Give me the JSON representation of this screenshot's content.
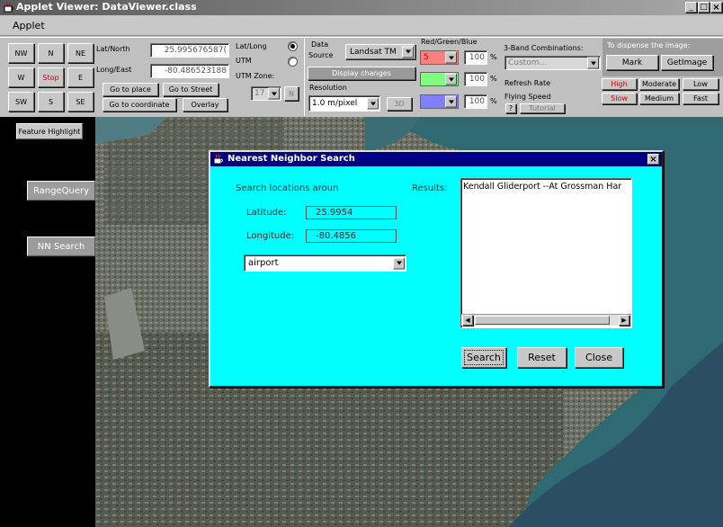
{
  "window": {
    "title": "Applet Viewer: DataViewer.class",
    "menu": "Applet",
    "controls": [
      "_",
      "□",
      "×"
    ]
  },
  "nav": {
    "buttons": [
      "NW",
      "N",
      "NE",
      "W",
      "Stop",
      "E",
      "SW",
      "S",
      "SE"
    ]
  },
  "coords": {
    "lat_label": "Lat/North",
    "lat_value": "25.995676587(",
    "long_label": "Long/East",
    "long_value": "-80.486523188",
    "go_place": "Go to place",
    "go_street": "Go to Street",
    "go_coord": "Go to coordinate",
    "overlay": "Overlay",
    "latlong_label": "Lat/Long",
    "utm_label": "UTM",
    "utm_zone_label": "UTM Zone:",
    "utm_zone_value": "17",
    "utm_hemi": "N"
  },
  "datasource": {
    "label1": "Data",
    "label2": "Source",
    "value": "Landsat TM",
    "display_changes": "Display changes",
    "resolution_label": "Resolution",
    "resolution_value": "1.0 m/pixel",
    "btn_3d": "3D"
  },
  "rgb": {
    "title": "Red/Green/Blue",
    "r_value": "100",
    "g_value": "100",
    "b_value": "100",
    "pct": "%",
    "r_sel": "5"
  },
  "band": {
    "title": "3-Band Combinations:",
    "value": "Custom...",
    "refresh_label": "Refresh Rate",
    "flying_label": "Flying Speed",
    "help": "?",
    "tutorial": "Tutorial"
  },
  "image": {
    "title": "To dispense the image:",
    "mark": "Mark",
    "getimage": "GetImage",
    "rate_high": "High",
    "rate_moderate": "Moderate",
    "rate_low": "Low",
    "speed_slow": "Slow",
    "speed_medium": "Medium",
    "speed_fast": "Fast"
  },
  "side": {
    "feature": "Feature Highlight",
    "range": "RangeQuery",
    "nn": "NN Search"
  },
  "dialog": {
    "title": "Nearest Neighbor Search",
    "search_label": "Search locations aroun",
    "lat_label": "Latitude:",
    "lat_value": "25.9954",
    "long_label": "Longitude:",
    "long_value": "-80.4856",
    "category": "airport",
    "results_label": "Results:",
    "results": [
      "Kendall Gliderport --At Grossman Har"
    ],
    "search": "Search",
    "reset": "Reset",
    "close": "Close"
  },
  "colors": {
    "dialog_bg": "#00ffff",
    "titlebar": "#000080",
    "side_bg": "#000000",
    "accent_red": "#d00000"
  }
}
